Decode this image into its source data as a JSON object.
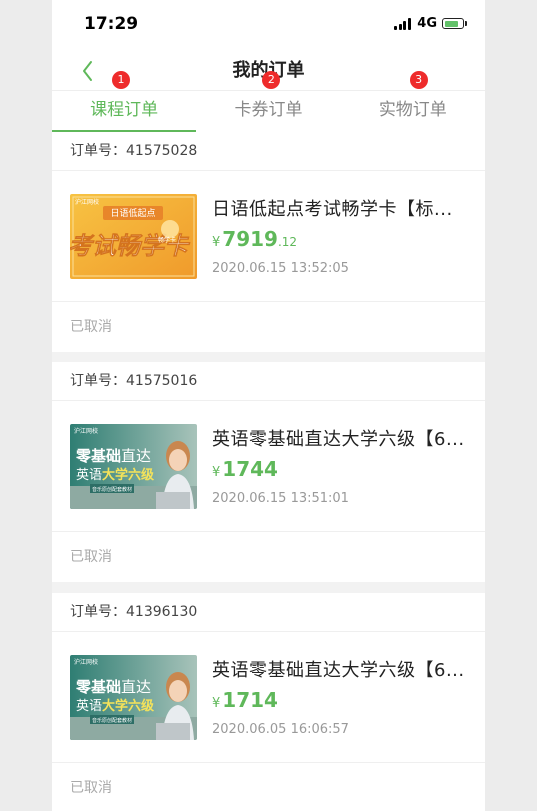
{
  "status_bar": {
    "time": "17:29",
    "network": "4G"
  },
  "nav": {
    "title": "我的订单"
  },
  "tabs": [
    {
      "label": "课程订单",
      "badge": "1",
      "active": true
    },
    {
      "label": "卡券订单",
      "badge": "2",
      "active": false
    },
    {
      "label": "实物订单",
      "badge": "3",
      "active": false
    }
  ],
  "orders": [
    {
      "order_label": "订单号：41575028",
      "title": "日语低起点考试畅学卡【标...",
      "yen": "¥",
      "price_int": "7919",
      "price_dec": ".12",
      "date": "2020.06.15 13:52:05",
      "status": "已取消",
      "thumb": {
        "top": "日语低起点",
        "main": "考试畅学卡",
        "sub": "畅学卡",
        "logo": "沪江网校"
      }
    },
    {
      "order_label": "订单号：41575016",
      "title": "英语零基础直达大学六级【6...",
      "yen": "¥",
      "price_int": "1744",
      "price_dec": "",
      "date": "2020.06.15 13:51:01",
      "status": "已取消",
      "thumb": {
        "logo": "沪江网校",
        "line1a": "零基础",
        "line1b": "直达",
        "line2a": "英语",
        "line2b": "大学六级",
        "tag": "音乐原创配套教材"
      }
    },
    {
      "order_label": "订单号：41396130",
      "title": "英语零基础直达大学六级【6...",
      "yen": "¥",
      "price_int": "1714",
      "price_dec": "",
      "date": "2020.06.05 16:06:57",
      "status": "已取消",
      "thumb": {
        "logo": "沪江网校",
        "line1a": "零基础",
        "line1b": "直达",
        "line2a": "英语",
        "line2b": "大学六级",
        "tag": "音乐原创配套教材"
      }
    }
  ],
  "colors": {
    "accent": "#5fb85a",
    "badge": "#ee2b2b",
    "bg": "#f2f2f2"
  }
}
